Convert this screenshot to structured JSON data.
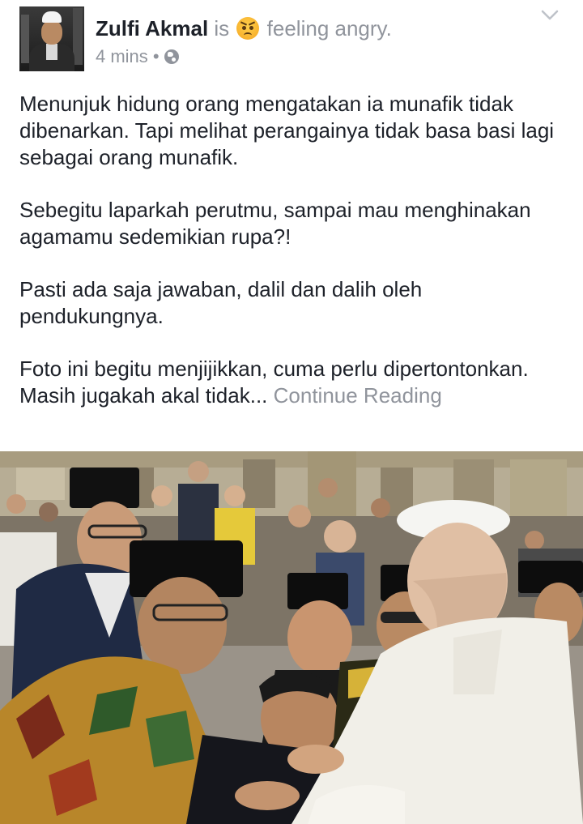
{
  "post": {
    "author": "Zulfi Akmal",
    "is_word": "is",
    "feeling_icon": "angry-emoji-icon",
    "feeling_text": "feeling angry.",
    "time": "4 mins",
    "separator": "•",
    "privacy_icon": "globe-icon",
    "menu_icon": "chevron-down-icon",
    "paragraphs": [
      "Menunjuk hidung orang mengatakan ia munafik tidak dibenarkan. Tapi melihat perangainya tidak basa basi lagi sebagai orang munafik.",
      "Sebegitu laparkah perutmu, sampai mau menghinakan agamamu sedemikian rupa?!",
      "Pasti ada saja jawaban, dalil dan dalih oleh pendukungnya.",
      "Foto ini begitu menjijikkan, cuma perlu dipertontonkan. Masih jugakah akal tidak..."
    ],
    "continue_label": "Continue Reading"
  },
  "colors": {
    "name": "#1d2129",
    "secondary": "#90949c",
    "body_text": "#1d2129",
    "background": "#ffffff"
  }
}
